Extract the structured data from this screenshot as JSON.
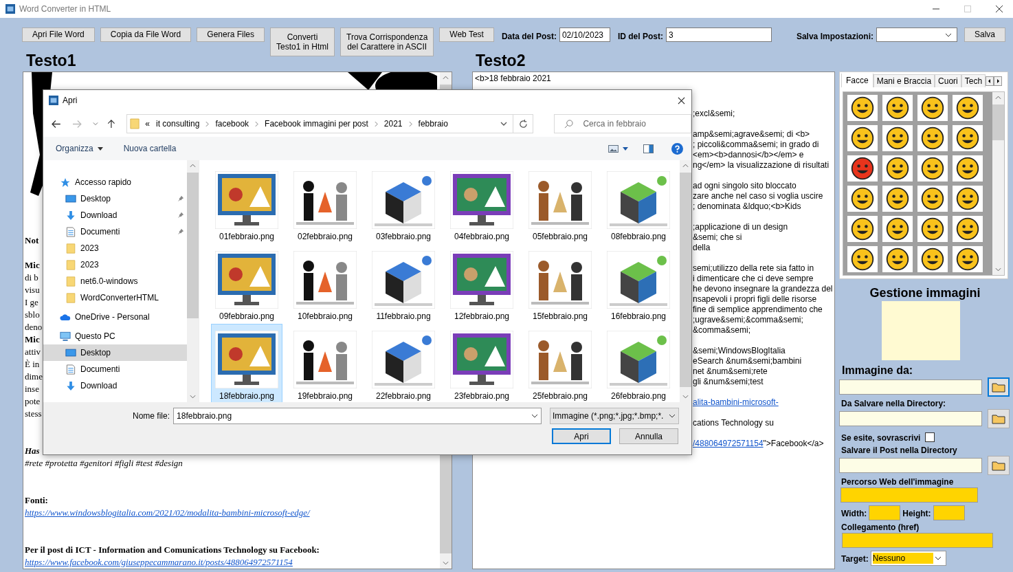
{
  "window": {
    "title": "Word Converter in HTML"
  },
  "toolbar": {
    "buttons": [
      {
        "lines": [
          "Apri File Word"
        ]
      },
      {
        "lines": [
          "Copia da File Word"
        ]
      },
      {
        "lines": [
          "Genera Files"
        ]
      },
      {
        "lines": [
          "Converti",
          "Testo1 in Html"
        ]
      },
      {
        "lines": [
          "Trova Corrispondenza",
          "del Carattere in ASCII"
        ]
      },
      {
        "lines": [
          "Web Test"
        ]
      }
    ],
    "post_date": {
      "label": "Data del Post:",
      "value": "02/10/2023"
    },
    "post_id": {
      "label": "ID del Post:",
      "value": "3"
    },
    "settings": {
      "label": "Salva Impostazioni:",
      "button": "Salva"
    }
  },
  "testo1": {
    "title": "Testo1",
    "paragraphs": [
      [
        {
          "text": "Not",
          "kind": "bold"
        }
      ],
      [
        {
          "text": "Mic",
          "kind": "bold"
        },
        {
          "text": "di b",
          "kind": "plain"
        },
        {
          "text": "visu",
          "kind": "plain"
        },
        {
          "text": "I ge",
          "kind": "plain"
        },
        {
          "text": "sblo",
          "kind": "plain"
        },
        {
          "text": "deno",
          "kind": "plain"
        },
        {
          "text": "Mic",
          "kind": "bold"
        },
        {
          "text": "attiv",
          "kind": "plain"
        },
        {
          "text": "È in",
          "kind": "plain"
        },
        {
          "text": "dime",
          "kind": "plain"
        },
        {
          "text": "inse",
          "kind": "plain"
        },
        {
          "text": "pote",
          "kind": "plain"
        },
        {
          "text": "stess",
          "kind": "plain"
        }
      ],
      [
        {
          "text": "Has",
          "kind": "bold_italic"
        },
        {
          "text": "#rete #protetta #genitori #figli #test #design",
          "kind": "italic"
        }
      ],
      [
        {
          "text": "Fonti:",
          "kind": "bold"
        },
        {
          "text": "https://www.windowsblogitalia.com/2021/02/modalita-bambini-microsoft-edge/",
          "kind": "link"
        }
      ],
      [
        {
          "text": "Per il post di ICT - Information and Comunications Technology su Facebook:",
          "kind": "bold"
        },
        {
          "text": "https://www.facebook.com/giuseppecammarano.it/posts/488064972571154",
          "kind": "link"
        }
      ]
    ]
  },
  "testo2": {
    "title": "Testo2",
    "first_line": "<b>18 febbraio 2021",
    "paragraphs": [
      [
        {
          "text": ";excl&semi;"
        }
      ],
      [
        {
          "text": "amp&semi;agrave&semi; di <b>"
        },
        {
          "text": "; piccoli&comma&semi; in grado di"
        },
        {
          "text": "<em><b>dannosi</b></em> e"
        },
        {
          "text": "ng</em> la visualizzazione di risultati"
        }
      ],
      [
        {
          "text": "ad ogni singolo sito bloccato"
        },
        {
          "text": "zare anche nel caso si voglia uscire"
        },
        {
          "text": "; denominata &ldquo;<b>Kids"
        }
      ],
      [
        {
          "text": ";applicazione di un design"
        },
        {
          "text": "&semi; che si"
        },
        {
          "text": "della"
        }
      ],
      [
        {
          "text": "semi;utilizzo della rete sia fatto in"
        },
        {
          "text": "i dimenticare che ci deve sempre"
        },
        {
          "text": "he devono insegnare la grandezza del"
        },
        {
          "text": "nsapevoli i propri figli delle risorse"
        },
        {
          "text": "fine di semplice apprendimento che"
        },
        {
          "text": ";ugrave&semi;&comma&semi;"
        },
        {
          "text": "&comma&semi;"
        }
      ],
      [
        {
          "text": "&semi;WindowsBlogItalia"
        },
        {
          "text": "eSearch &num&semi;bambini"
        },
        {
          "text": "net &num&semi;rete"
        },
        {
          "text": "gli &num&semi;test"
        }
      ],
      [
        {
          "link": "alita-bambini-microsoft-"
        }
      ],
      [
        {
          "text": "cations Technology su"
        }
      ],
      [
        {
          "link": "/488064972571154",
          "text": "\">Facebook</a>"
        }
      ]
    ]
  },
  "sidebar": {
    "tabs": [
      {
        "label": "Facce",
        "selected": true
      },
      {
        "label": "Mani e Braccia",
        "selected": false
      },
      {
        "label": "Cuori",
        "selected": false
      },
      {
        "label": "Tech",
        "selected": false
      }
    ],
    "title": "Gestione immagini",
    "image_from": {
      "label": "Immagine da:"
    },
    "save_dir": {
      "label": "Da Salvare nella Directory:"
    },
    "overwrite": {
      "label": "Se esite, sovrascrivi",
      "checked": false
    },
    "post_dir": {
      "label": "Salvare il Post nella Directory"
    },
    "web_path": {
      "label": "Percorso Web dell'immagine"
    },
    "width": {
      "label": "Width:"
    },
    "height": {
      "label": "Height:"
    },
    "href": {
      "label": "Collegamento (href)"
    },
    "target": {
      "label": "Target:",
      "value": "Nessuno"
    }
  },
  "dialog": {
    "title": "Apri",
    "address_overflow": "«",
    "crumbs": [
      "it consulting",
      "facebook",
      "Facebook immagini per post",
      "2021",
      "febbraio"
    ],
    "search": {
      "placeholder": "Cerca in febbraio"
    },
    "commands": {
      "organize": "Organizza",
      "new_folder": "Nuova cartella"
    },
    "nav": [
      {
        "label": "Accesso rapido",
        "kind": "quick",
        "selected": false,
        "children": [
          {
            "label": "Desktop",
            "kind": "desktop",
            "selected": false,
            "pinned": true
          },
          {
            "label": "Download",
            "kind": "download",
            "selected": false,
            "pinned": true
          },
          {
            "label": "Documenti",
            "kind": "documents",
            "selected": false,
            "pinned": true
          },
          {
            "label": "2023",
            "kind": "folder",
            "selected": false,
            "pinned": false
          },
          {
            "label": "2023",
            "kind": "folder",
            "selected": false,
            "pinned": false
          },
          {
            "label": "net6.0-windows",
            "kind": "folder",
            "selected": false,
            "pinned": false
          },
          {
            "label": "WordConverterHTML",
            "kind": "folder",
            "selected": false,
            "pinned": false
          }
        ]
      },
      {
        "label": "OneDrive - Personal",
        "kind": "cloud",
        "selected": false
      },
      {
        "label": "Questo PC",
        "kind": "pc",
        "selected": false,
        "children": [
          {
            "label": "Desktop",
            "kind": "desktop",
            "selected": true,
            "pinned": false
          },
          {
            "label": "Documenti",
            "kind": "documents",
            "selected": false,
            "pinned": false
          },
          {
            "label": "Download",
            "kind": "download",
            "selected": false,
            "pinned": false
          }
        ]
      }
    ],
    "files": [
      {
        "name": "01febbraio.png",
        "selected": false
      },
      {
        "name": "02febbraio.png",
        "selected": false
      },
      {
        "name": "03febbraio.png",
        "selected": false
      },
      {
        "name": "04febbraio.png",
        "selected": false
      },
      {
        "name": "05febbraio.png",
        "selected": false
      },
      {
        "name": "08febbraio.png",
        "selected": false
      },
      {
        "name": "09febbraio.png",
        "selected": false
      },
      {
        "name": "10febbraio.png",
        "selected": false
      },
      {
        "name": "11febbraio.png",
        "selected": false
      },
      {
        "name": "12febbraio.png",
        "selected": false
      },
      {
        "name": "15febbraio.png",
        "selected": false
      },
      {
        "name": "16febbraio.png",
        "selected": false
      },
      {
        "name": "18febbraio.png",
        "selected": true
      },
      {
        "name": "19febbraio.png",
        "selected": false
      },
      {
        "name": "22febbraio.png",
        "selected": false
      },
      {
        "name": "23febbraio.png",
        "selected": false
      },
      {
        "name": "25febbraio.png",
        "selected": false
      },
      {
        "name": "26febbraio.png",
        "selected": false
      }
    ],
    "filename": {
      "label": "Nome file:",
      "value": "18febbraio.png"
    },
    "filter": {
      "value": "Immagine (*.png;*.jpg;*.bmp;*."
    },
    "buttons": {
      "open": "Apri",
      "cancel": "Annulla"
    }
  }
}
